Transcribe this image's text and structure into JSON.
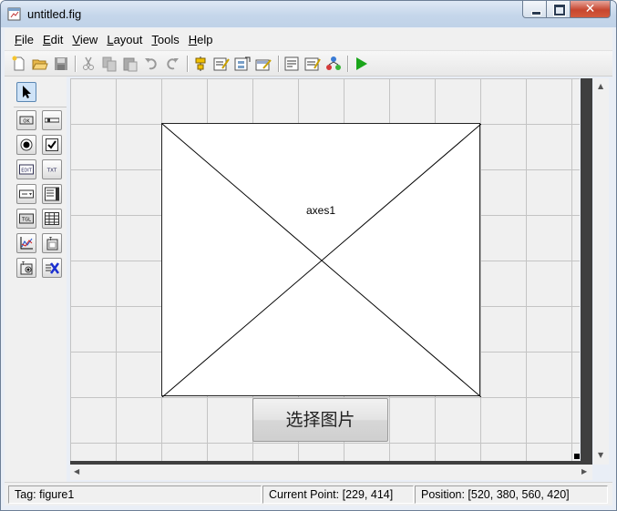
{
  "window": {
    "title": "untitled.fig",
    "icon": "matlab-fig-icon",
    "controls": [
      "minimize-icon",
      "maximize-icon",
      "close-icon"
    ],
    "close_glyph": "✕"
  },
  "menubar": {
    "items": [
      {
        "label": "File",
        "mnemonic": "F",
        "rest": "ile"
      },
      {
        "label": "Edit",
        "mnemonic": "E",
        "rest": "dit"
      },
      {
        "label": "View",
        "mnemonic": "V",
        "rest": "iew"
      },
      {
        "label": "Layout",
        "mnemonic": "L",
        "rest": "ayout"
      },
      {
        "label": "Tools",
        "mnemonic": "T",
        "rest": "ools"
      },
      {
        "label": "Help",
        "mnemonic": "H",
        "rest": "elp"
      }
    ]
  },
  "toolbar": {
    "buttons": [
      "new-icon",
      "open-icon",
      "save-icon",
      "cut-icon",
      "copy-icon",
      "paste-icon",
      "undo-icon",
      "redo-icon",
      "align-icon",
      "menu-editor-icon",
      "tab-order-icon",
      "toolbar-editor-icon",
      "mfile-editor-icon",
      "property-inspector-icon",
      "object-browser-icon",
      "run-icon"
    ]
  },
  "palette": {
    "tools": [
      "select-arrow-icon",
      "push-button-icon",
      "slider-icon",
      "radio-button-icon",
      "checkbox-icon",
      "edit-text-icon",
      "static-text-icon",
      "popup-menu-icon",
      "listbox-icon",
      "toggle-button-icon",
      "table-icon",
      "axes-icon",
      "panel-icon",
      "button-group-icon",
      "activex-icon"
    ],
    "labels": {
      "push": "OK",
      "edit": "EDIT",
      "text": "TXT",
      "toggle": "TGL"
    }
  },
  "canvas": {
    "axes_label": "axes1",
    "push_button_label": "选择图片"
  },
  "statusbar": {
    "tag": "Tag: figure1",
    "current_point": "Current Point:  [229, 414]",
    "position": "Position: [520, 380, 560, 420]"
  },
  "colors": {
    "run_green": "#1aa51a",
    "selection_blue": "#cfe3f7",
    "grid_line": "#c4c4c4",
    "close_red": "#c7462f"
  }
}
